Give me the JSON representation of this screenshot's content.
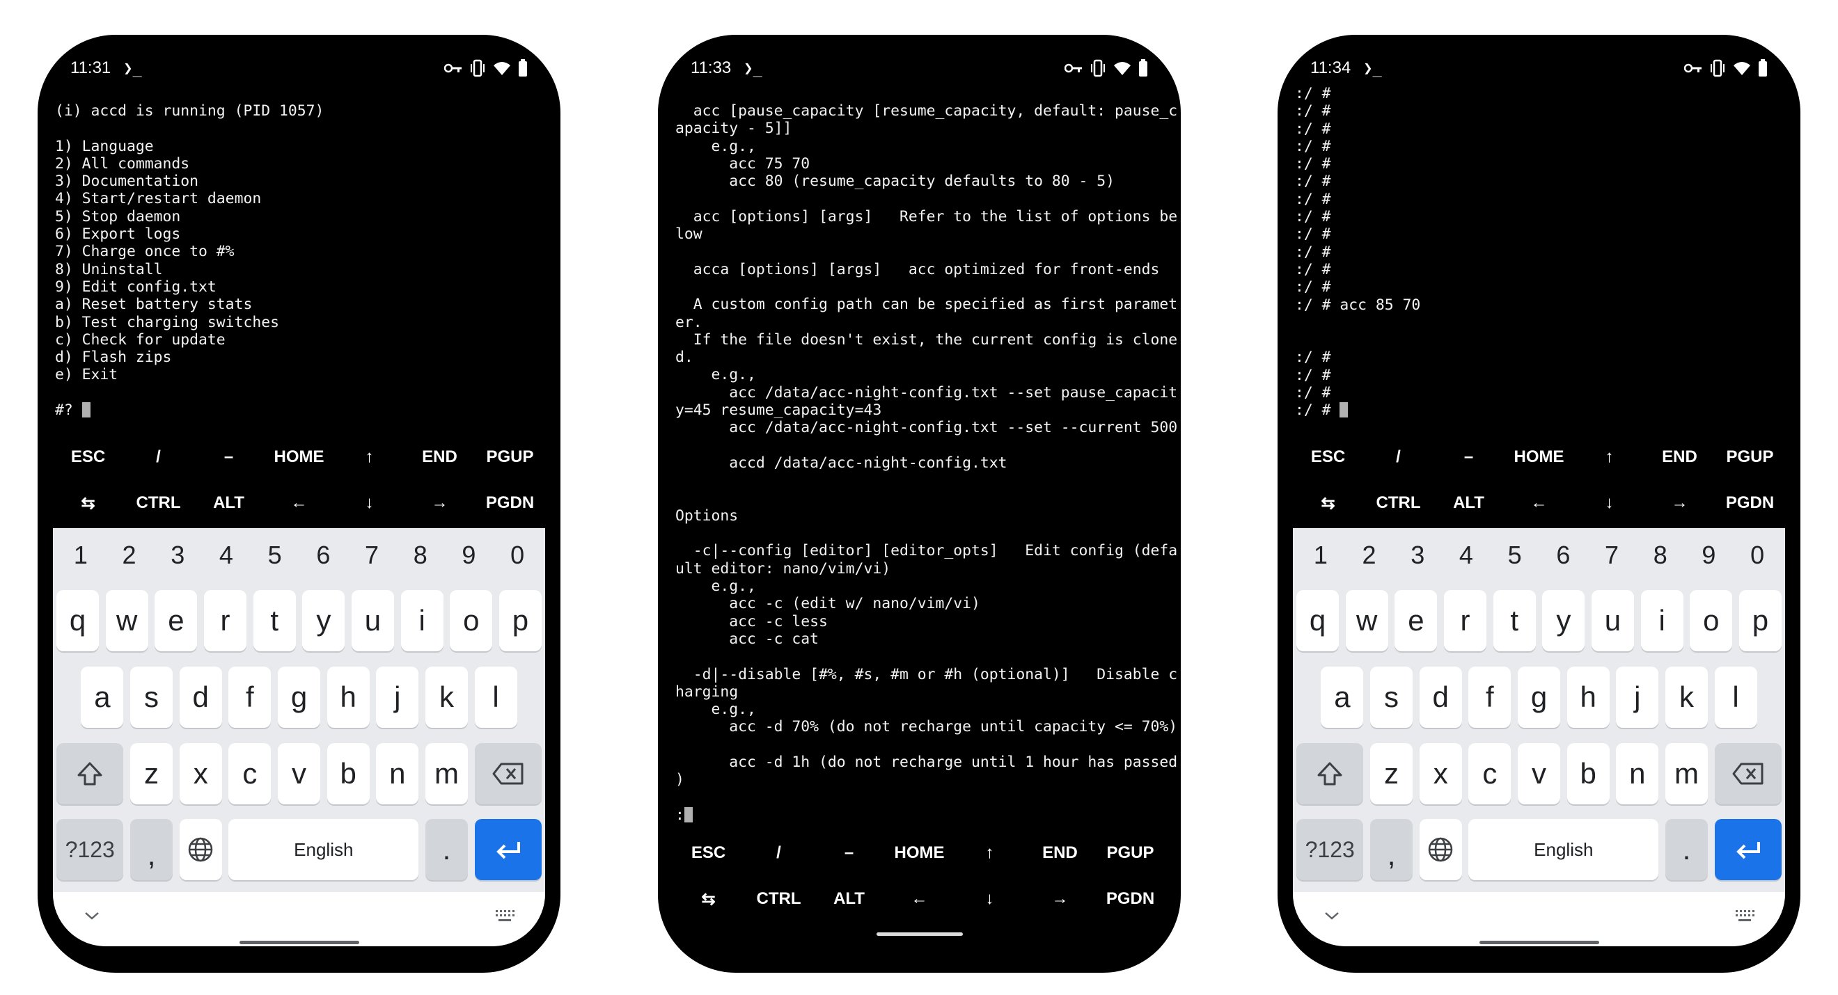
{
  "extra_keys": {
    "row1": [
      "ESC",
      "/",
      "–",
      "HOME",
      "↑",
      "END",
      "PGUP"
    ],
    "row2": [
      "⇆",
      "CTRL",
      "ALT",
      "←",
      "↓",
      "→",
      "PGDN"
    ]
  },
  "keyboard": {
    "numbers": [
      "1",
      "2",
      "3",
      "4",
      "5",
      "6",
      "7",
      "8",
      "9",
      "0"
    ],
    "row1": [
      "q",
      "w",
      "e",
      "r",
      "t",
      "y",
      "u",
      "i",
      "o",
      "p"
    ],
    "row2": [
      "a",
      "s",
      "d",
      "f",
      "g",
      "h",
      "j",
      "k",
      "l"
    ],
    "row3": [
      "z",
      "x",
      "c",
      "v",
      "b",
      "n",
      "m"
    ],
    "symbols_label": "?123",
    "comma": ",",
    "period": ".",
    "space_label": "English",
    "accent_color": "#1a73e8"
  },
  "phones": [
    {
      "time": "11:31",
      "status_glyph": "❯_",
      "keyboard_visible": true,
      "lines": [
        "(i) accd is running (PID 1057)",
        "",
        "1) Language",
        "2) All commands",
        "3) Documentation",
        "4) Start/restart daemon",
        "5) Stop daemon",
        "6) Export logs",
        "7) Charge once to #%",
        "8) Uninstall",
        "9) Edit config.txt",
        "a) Reset battery stats",
        "b) Test charging switches",
        "c) Check for update",
        "d) Flash zips",
        "e) Exit",
        ""
      ],
      "prompt": "#? "
    },
    {
      "time": "11:33",
      "status_glyph": "❯_",
      "keyboard_visible": false,
      "lines": [
        "  acc [pause_capacity [resume_capacity, default: pause_c",
        "apacity - 5]]",
        "    e.g.,",
        "      acc 75 70",
        "      acc 80 (resume_capacity defaults to 80 - 5)",
        "",
        "  acc [options] [args]   Refer to the list of options be",
        "low",
        "",
        "  acca [options] [args]   acc optimized for front-ends",
        "",
        "  A custom config path can be specified as first paramet",
        "er.",
        "  If the file doesn't exist, the current config is clone",
        "d.",
        "    e.g.,",
        "      acc /data/acc-night-config.txt --set pause_capacit",
        "y=45 resume_capacity=43",
        "      acc /data/acc-night-config.txt --set --current 500",
        "",
        "      accd /data/acc-night-config.txt",
        "",
        "",
        "Options",
        "",
        "  -c|--config [editor] [editor_opts]   Edit config (defa",
        "ult editor: nano/vim/vi)",
        "    e.g.,",
        "      acc -c (edit w/ nano/vim/vi)",
        "      acc -c less",
        "      acc -c cat",
        "",
        "  -d|--disable [#%, #s, #m or #h (optional)]   Disable c",
        "harging",
        "    e.g.,",
        "      acc -d 70% (do not recharge until capacity <= 70%)",
        "",
        "      acc -d 1h (do not recharge until 1 hour has passed",
        ")",
        ""
      ],
      "prompt": ":"
    },
    {
      "time": "11:34",
      "status_glyph": "❯_",
      "keyboard_visible": true,
      "lines": [
        ":/ #",
        ":/ #",
        ":/ #",
        ":/ #",
        ":/ #",
        ":/ #",
        ":/ #",
        ":/ #",
        ":/ #",
        ":/ #",
        ":/ #",
        ":/ #",
        ":/ # acc 85 70",
        "",
        "",
        ":/ #",
        ":/ #",
        ":/ #"
      ],
      "prompt": ":/ # "
    }
  ]
}
